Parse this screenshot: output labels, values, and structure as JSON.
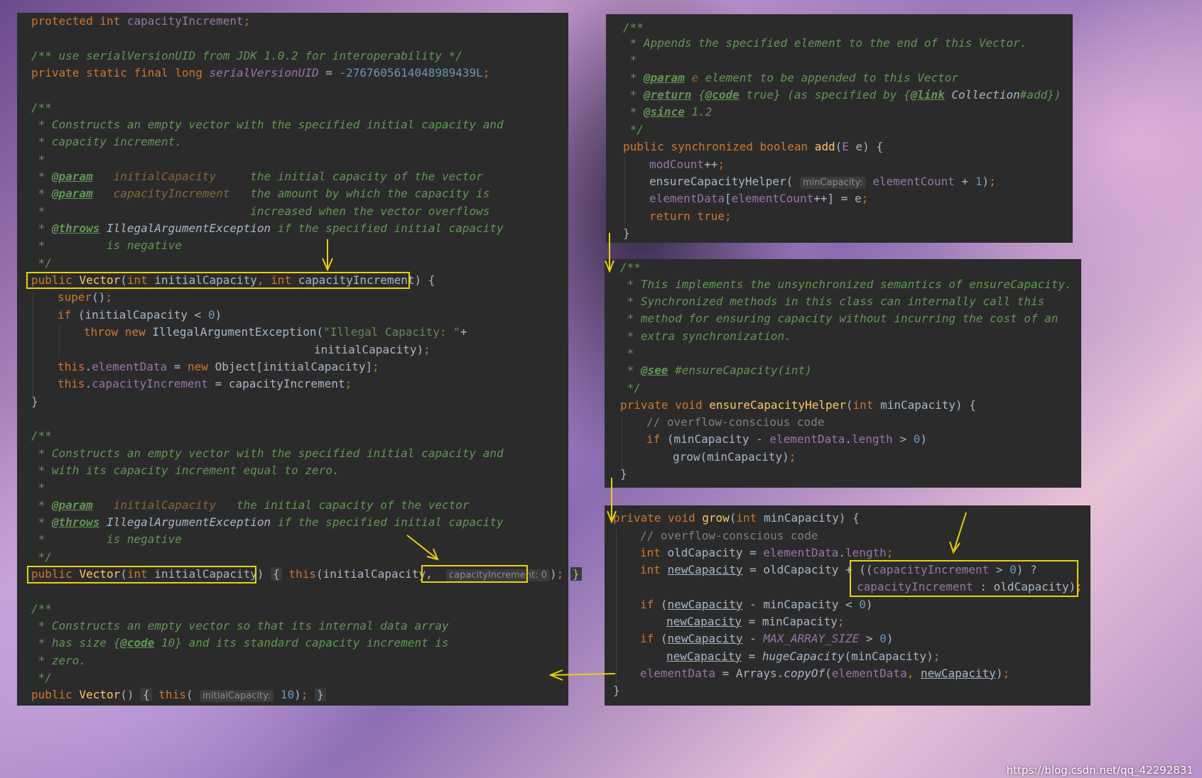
{
  "left_panel": {
    "field_capacity_increment": "protected int capacityIncrement;",
    "serial_comment": "/** use serialVersionUID from JDK 1.0.2 for interoperability */",
    "serial_decl": "private static final long serialVersionUID = -2767605614048989439L;",
    "ctor1_doc": [
      "/**",
      " * Constructs an empty vector with the specified initial capacity and",
      " * capacity increment.",
      " *",
      " * @param   initialCapacity     the initial capacity of the vector",
      " * @param   capacityIncrement   the amount by which the capacity is",
      " *                              increased when the vector overflows",
      " * @throws IllegalArgumentException if the specified initial capacity",
      " *         is negative",
      " */"
    ],
    "ctor1_signature": "public Vector(int initialCapacity, int capacityIncrement)",
    "ctor1_body": [
      "super();",
      "if (initialCapacity < 0)",
      "throw new IllegalArgumentException(\"Illegal Capacity: \"+",
      "initialCapacity);",
      "this.elementData = new Object[initialCapacity];",
      "this.capacityIncrement = capacityIncrement;",
      "}"
    ],
    "ctor2_doc": [
      "/**",
      " * Constructs an empty vector with the specified initial capacity and",
      " * with its capacity increment equal to zero.",
      " *",
      " * @param   initialCapacity   the initial capacity of the vector",
      " * @throws IllegalArgumentException if the specified initial capacity",
      " *         is negative",
      " */"
    ],
    "ctor2_signature": "public Vector(int initialCapacity)",
    "ctor2_body": "this(initialCapacity,",
    "ctor2_hint": "capacityIncrement:",
    "ctor2_hint_value": "0",
    "ctor3_doc": [
      "/**",
      " * Constructs an empty vector so that its internal data array",
      " * has size {@code 10} and its standard capacity increment is",
      " * zero.",
      " */"
    ],
    "ctor3_signature": "public Vector()",
    "ctor3_body": "this(",
    "ctor3_hint": "initialCapacity:",
    "ctor3_hint_value": "10"
  },
  "add_panel": {
    "doc": [
      "/**",
      " * Appends the specified element to the end of this Vector.",
      " *",
      " * @param e element to be appended to this Vector",
      " * @return {@code true} (as specified by {@link Collection#add})",
      " * @since 1.2",
      " */"
    ],
    "signature": "public synchronized boolean add(E e) {",
    "body": [
      "modCount++;",
      "ensureCapacityHelper(",
      "elementData[elementCount++] = e;",
      "return true;",
      "}"
    ],
    "hint": "minCapacity:",
    "hint_arg": "elementCount + 1);"
  },
  "ensure_panel": {
    "doc": [
      "/**",
      " * This implements the unsynchronized semantics of ensureCapacity.",
      " * Synchronized methods in this class can internally call this",
      " * method for ensuring capacity without incurring the cost of an",
      " * extra synchronization.",
      " *",
      " * @see #ensureCapacity(int)",
      " */"
    ],
    "signature": "private void ensureCapacityHelper(int minCapacity) {",
    "body": [
      "// overflow-conscious code",
      "if (minCapacity - elementData.length > 0)",
      "grow(minCapacity);",
      "}"
    ]
  },
  "grow_panel": {
    "signature": "private void grow(int minCapacity) {",
    "body": [
      "// overflow-conscious code",
      "int oldCapacity = elementData.length;",
      "int newCapacity = oldCapacity + ((capacityIncrement > 0) ?",
      "capacityIncrement : oldCapacity);",
      "if (newCapacity - minCapacity < 0)",
      "newCapacity = minCapacity;",
      "if (newCapacity - MAX_ARRAY_SIZE > 0)",
      "newCapacity = hugeCapacity(minCapacity);",
      "elementData = Arrays.copyOf(elementData, newCapacity);",
      "}"
    ]
  },
  "watermark": "https://blog.csdn.net/qq_42292831",
  "colors": {
    "background": "#2b2b2b",
    "keyword": "#cc7832",
    "comment": "#629755",
    "field": "#9876aa",
    "number": "#6897bb",
    "method": "#ffc66d",
    "highlight": "#e8d20a"
  }
}
